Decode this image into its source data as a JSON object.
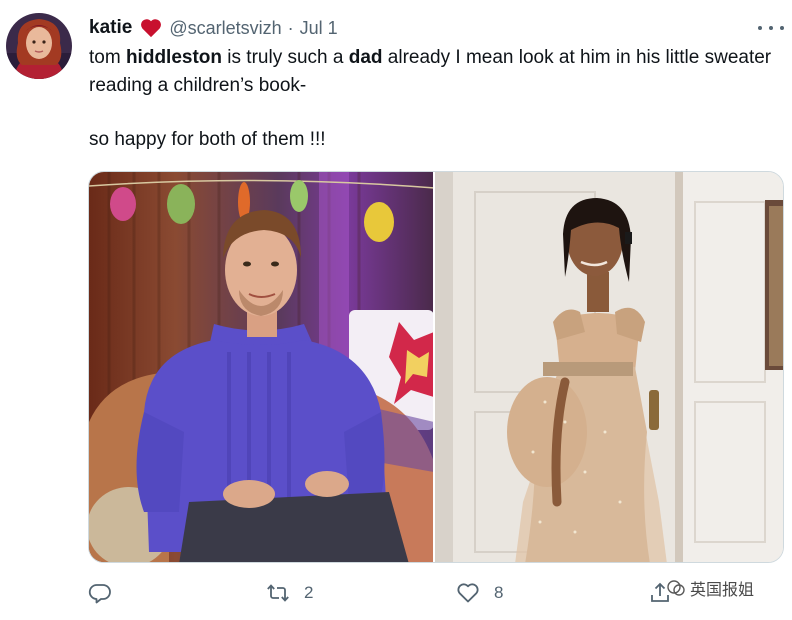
{
  "author": {
    "display_name": "katie",
    "handle": "@scarletsvizh",
    "separator": "·",
    "date": "Jul 1"
  },
  "tweet": {
    "line1_a": "tom ",
    "line1_b": "hiddleston",
    "line1_c": " is truly such a ",
    "line1_d": "dad",
    "line1_e": " already I mean look at him in his little sweater reading a children’s book-",
    "line2": "so happy for both of them !!!"
  },
  "actions": {
    "retweet_count": "2",
    "like_count": "8"
  },
  "watermark": {
    "text": "英国报姐"
  },
  "icons": {
    "more": "more-horizontal-icon",
    "heart_emoji": "red-heart-icon",
    "reply": "reply-icon",
    "retweet": "retweet-icon",
    "like": "like-icon",
    "share": "share-icon"
  },
  "colors": {
    "text_primary": "#0f1419",
    "text_secondary": "#536471",
    "border": "#cfd9de",
    "heart_red": "#c8102e",
    "sweater_purple": "#5b4fc9",
    "dress_gold": "#d8b99a"
  }
}
